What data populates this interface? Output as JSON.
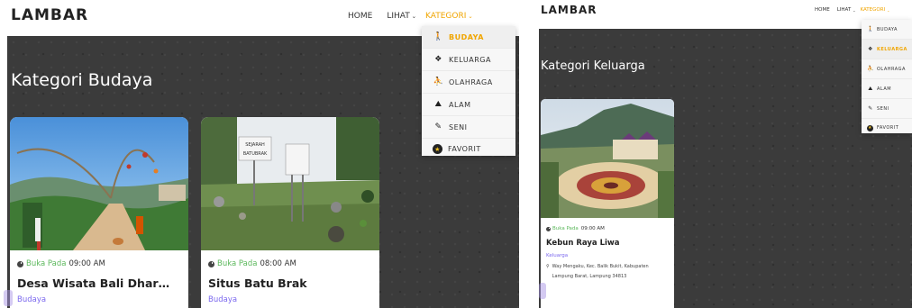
{
  "left": {
    "brand": "LAMBAR",
    "nav": {
      "home": "HOME",
      "lihat": "LIHAT",
      "kategori": "KATEGORI",
      "caret": "⌄"
    },
    "page_title": "Kategori Budaya",
    "dropdown": [
      {
        "icon": "🚶",
        "label": "BUDAYA"
      },
      {
        "icon": "❖",
        "label": "KELUARGA"
      },
      {
        "icon": "⛹",
        "label": "OLAHRAGA"
      },
      {
        "icon": "⛰",
        "label": "ALAM"
      },
      {
        "icon": "✎",
        "label": "SENI"
      },
      {
        "icon": "★",
        "label": "FAVORIT"
      }
    ],
    "cards": [
      {
        "open_label": "Buka Pada",
        "open_time": "09:00 AM",
        "title": "Desa Wisata Bali Dharma Kerti...",
        "category": "Budaya"
      },
      {
        "open_label": "Buka Pada",
        "open_time": "08:00 AM",
        "title": "Situs Batu Brak",
        "category": "Budaya",
        "sign_text_1": "SEJARAH",
        "sign_text_2": "BATUBRAK"
      }
    ]
  },
  "right": {
    "brand": "LAMBAR",
    "nav": {
      "home": "HOME",
      "lihat": "LIHAT",
      "kategori": "KATEGORI",
      "caret": "⌄"
    },
    "page_title": "Kategori Keluarga",
    "dropdown": [
      {
        "icon": "🚶",
        "label": "BUDAYA"
      },
      {
        "icon": "❖",
        "label": "KELUARGA"
      },
      {
        "icon": "⛹",
        "label": "OLAHRAGA"
      },
      {
        "icon": "⛰",
        "label": "ALAM"
      },
      {
        "icon": "✎",
        "label": "SENI"
      },
      {
        "icon": "★",
        "label": "FAVORIT"
      }
    ],
    "cards": [
      {
        "open_label": "Buka Pada",
        "open_time": "09:00 AM",
        "title": "Kebun Raya Liwa",
        "category": "Keluarga",
        "pin": "⚲",
        "address": "Way Mengaku, Kec. Balik Bukit, Kabupaten Lampung Barat, Lampung 34813"
      }
    ]
  },
  "colors": {
    "accent": "#f0a500",
    "open_green": "#5cb85c",
    "category_purple": "#7b68ee",
    "hero_bg": "#3b3b3b"
  }
}
